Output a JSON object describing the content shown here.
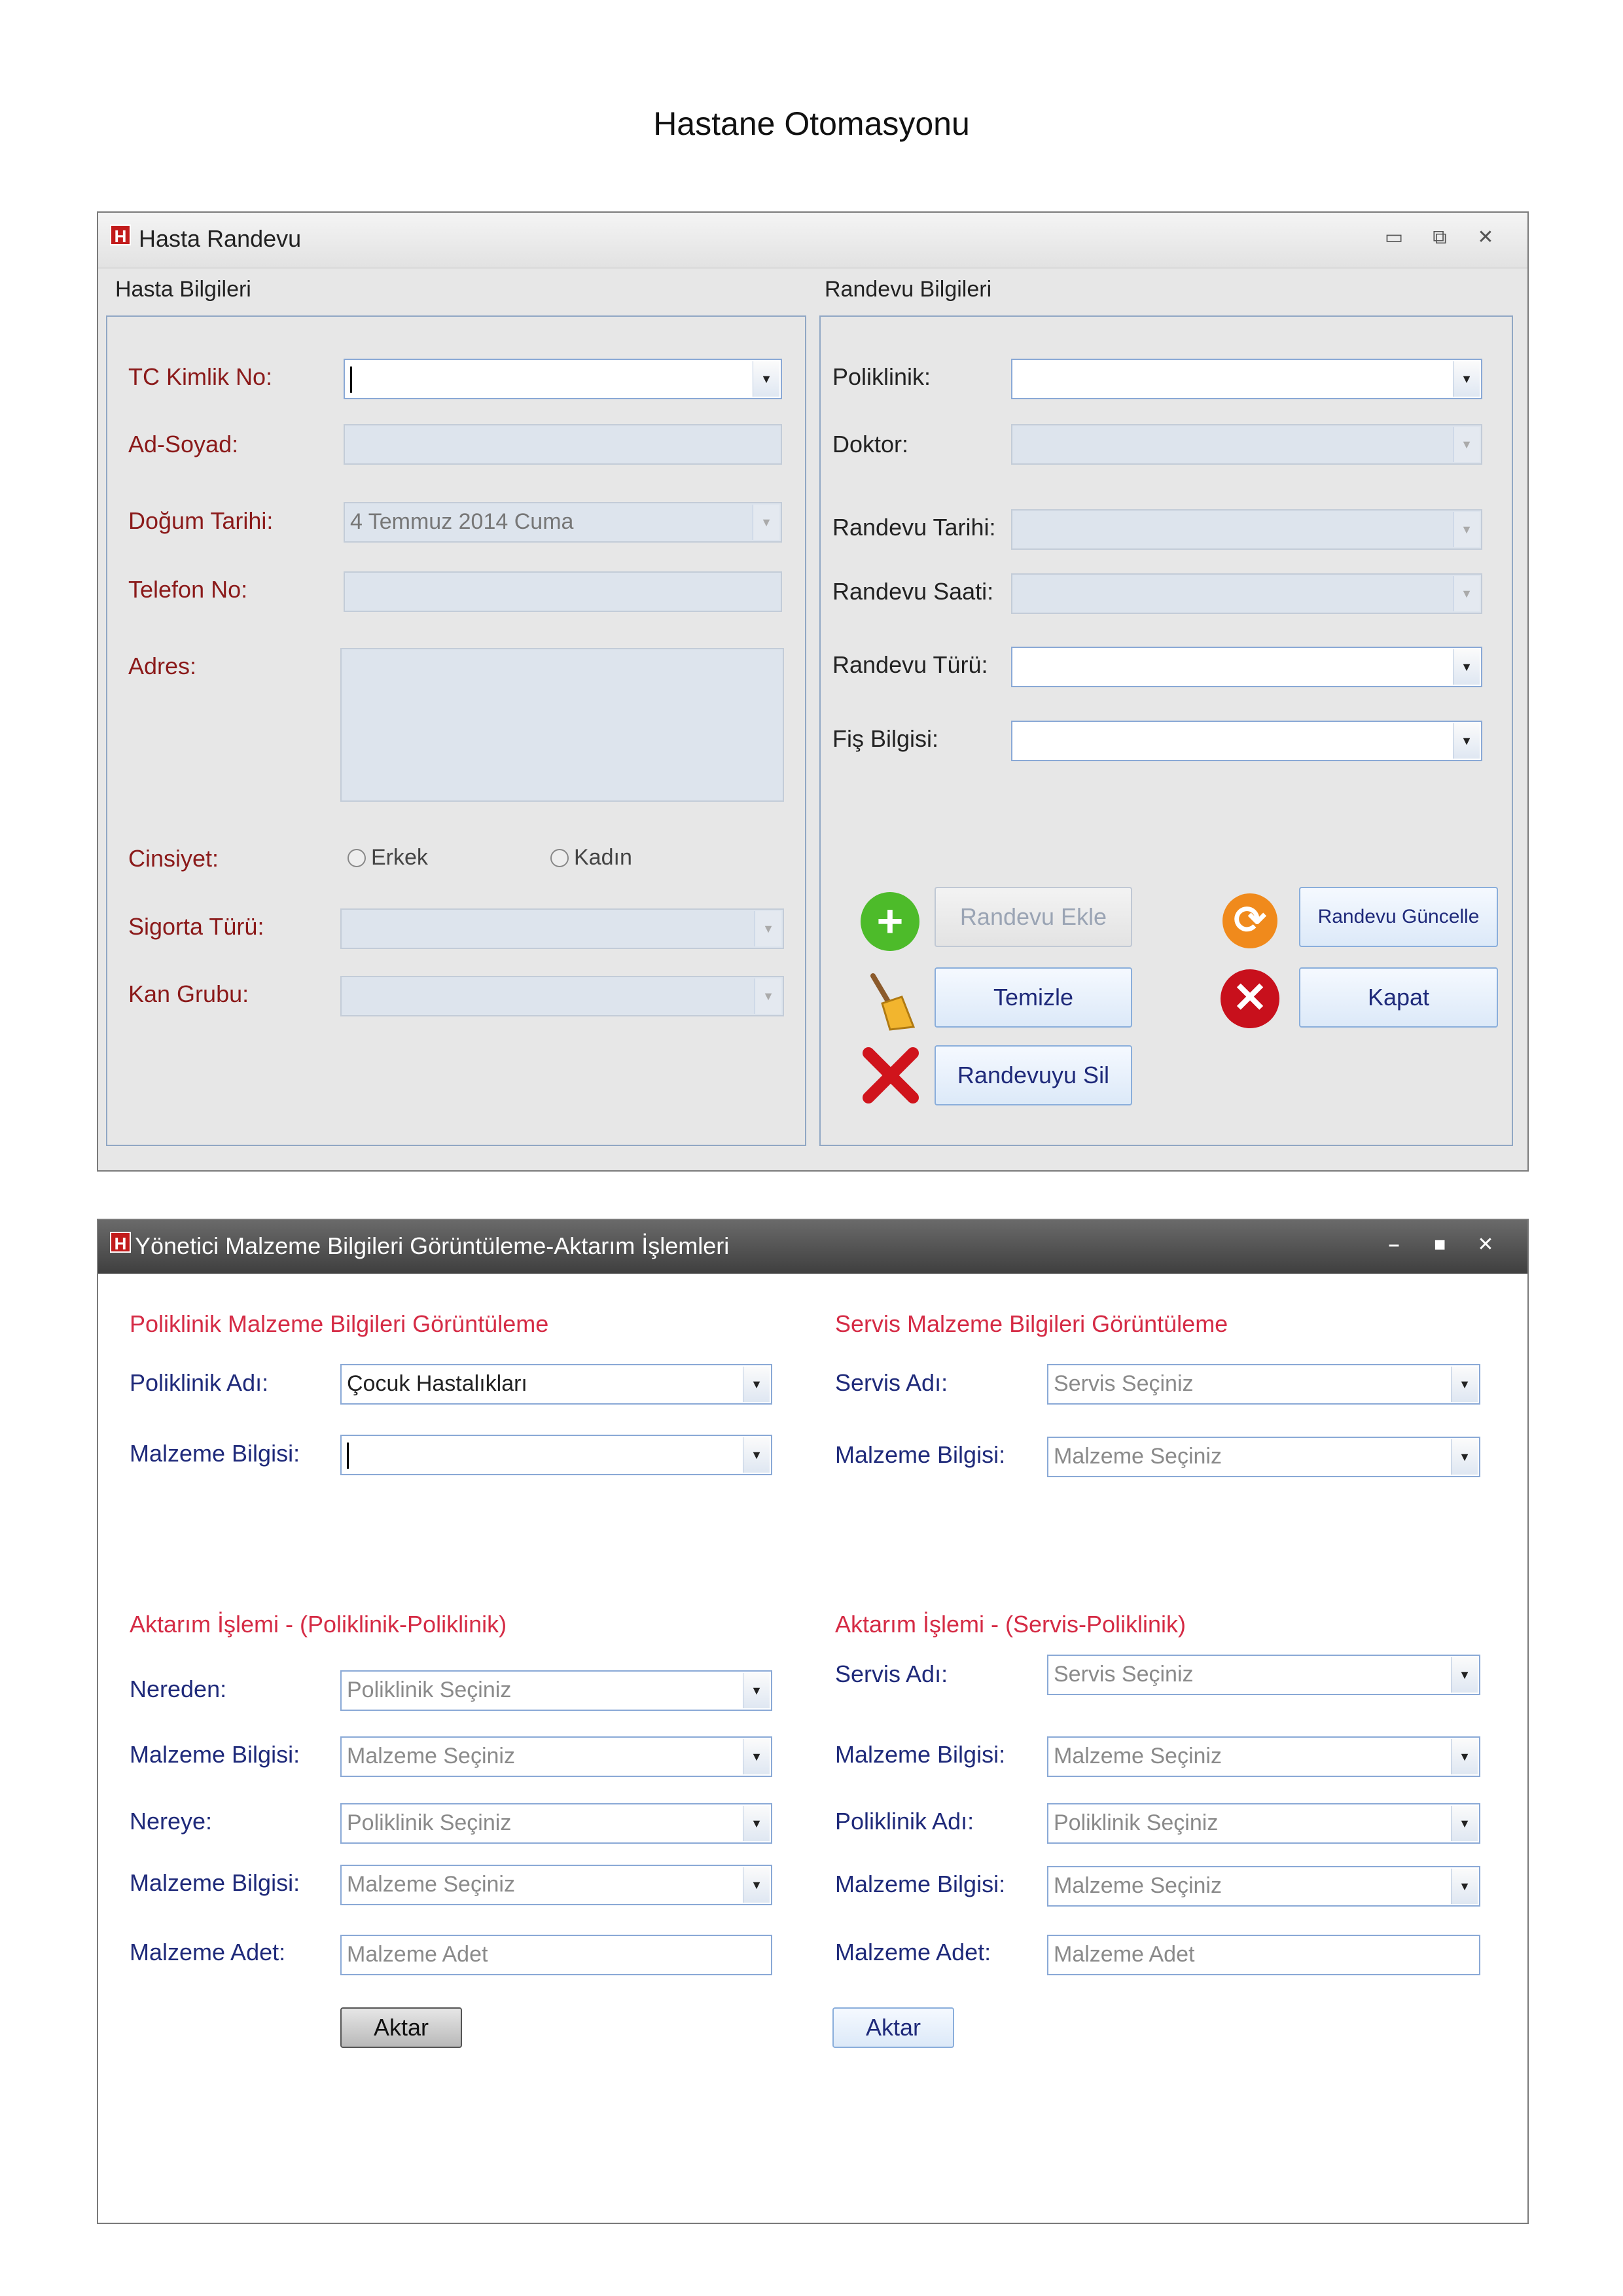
{
  "page_title": "Hastane Otomasyonu",
  "window1": {
    "title": "Hasta Randevu",
    "patient": {
      "group_title": "Hasta Bilgileri",
      "tc_label": "TC Kimlik No:",
      "ad_label": "Ad-Soyad:",
      "dogum_label": "Doğum Tarihi:",
      "dogum_value": "4 Temmuz 2014 Cuma",
      "telefon_label": "Telefon No:",
      "adres_label": "Adres:",
      "cinsiyet_label": "Cinsiyet:",
      "erkek": "Erkek",
      "kadin": "Kadın",
      "sigorta_label": "Sigorta Türü:",
      "kan_label": "Kan Grubu:"
    },
    "appointment": {
      "group_title": "Randevu Bilgileri",
      "poliklinik_label": "Poliklinik:",
      "doktor_label": "Doktor:",
      "tarih_label": "Randevu Tarihi:",
      "saat_label": "Randevu Saati:",
      "tur_label": "Randevu Türü:",
      "fis_label": "Fiş Bilgisi:"
    },
    "buttons": {
      "ekle": "Randevu Ekle",
      "guncelle": "Randevu Güncelle",
      "temizle": "Temizle",
      "kapat": "Kapat",
      "sil": "Randevuyu Sil"
    }
  },
  "window2": {
    "title": "Yönetici Malzeme Bilgileri Görüntüleme-Aktarım İşlemleri",
    "left_view": {
      "section_title": "Poliklinik Malzeme Bilgileri Görüntüleme",
      "poliklinik_label": "Poliklinik Adı:",
      "poliklinik_value": "Çocuk Hastalıkları",
      "malzeme_label": "Malzeme Bilgisi:"
    },
    "right_view": {
      "section_title": "Servis Malzeme Bilgileri Görüntüleme",
      "servis_label": "Servis Adı:",
      "servis_placeholder": "Servis Seçiniz",
      "malzeme_label": "Malzeme Bilgisi:",
      "malzeme_placeholder": "Malzeme Seçiniz"
    },
    "left_transfer": {
      "section_title": "Aktarım İşlemi - (Poliklinik-Poliklinik)",
      "nereden_label": "Nereden:",
      "nereden_placeholder": "Poliklinik Seçiniz",
      "malzeme1_label": "Malzeme Bilgisi:",
      "malzeme1_placeholder": "Malzeme Seçiniz",
      "nereye_label": "Nereye:",
      "nereye_placeholder": "Poliklinik Seçiniz",
      "malzeme2_label": "Malzeme Bilgisi:",
      "malzeme2_placeholder": "Malzeme Seçiniz",
      "adet_label": "Malzeme Adet:",
      "adet_placeholder": "Malzeme Adet",
      "button": "Aktar"
    },
    "right_transfer": {
      "section_title": "Aktarım İşlemi - (Servis-Poliklinik)",
      "servis_label": "Servis Adı:",
      "servis_placeholder": "Servis Seçiniz",
      "malzeme1_label": "Malzeme Bilgisi:",
      "malzeme1_placeholder": "Malzeme Seçiniz",
      "poliklinik_label": "Poliklinik Adı:",
      "poliklinik_placeholder": "Poliklinik Seçiniz",
      "malzeme2_label": "Malzeme Bilgisi:",
      "malzeme2_placeholder": "Malzeme Seçiniz",
      "adet_label": "Malzeme Adet:",
      "adet_placeholder": "Malzeme Adet",
      "button": "Aktar"
    }
  },
  "colors": {
    "label_red": "#8b1a1a",
    "label_navy": "#1f2a7a",
    "section_red": "#d52b45",
    "field_border": "#8aa9d6",
    "disabled_fill": "#dde4ed"
  },
  "icons": [
    "app-logo-icon",
    "minimize-icon",
    "maximize-icon",
    "close-icon",
    "add-icon",
    "refresh-icon",
    "broom-icon",
    "cancel-icon",
    "delete-x-icon"
  ]
}
